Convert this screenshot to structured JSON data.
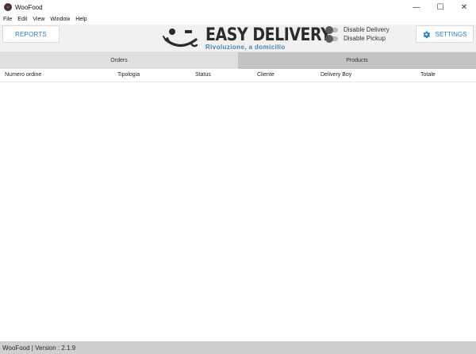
{
  "window": {
    "title": "WooFood",
    "minimize_glyph": "—",
    "maximize_glyph": "☐",
    "close_glyph": "✕"
  },
  "menu": [
    "File",
    "Edit",
    "View",
    "Window",
    "Help"
  ],
  "header": {
    "reports_label": "REPORTS",
    "logo_title": "EASY DELIVERY",
    "logo_subtitle": "Rivoluzione, a domicilio",
    "toggles": [
      {
        "label": "Disable Delivery",
        "on": false
      },
      {
        "label": "Disable Pickup",
        "on": false
      }
    ],
    "settings_label": "SETTINGS",
    "settings_icon": "gear-icon"
  },
  "tabs": [
    {
      "label": "Orders",
      "active": true
    },
    {
      "label": "Products",
      "active": false
    }
  ],
  "table": {
    "columns": [
      "Numero ordine",
      "Tipologia",
      "Status",
      "Cliente",
      "Delivery Boy",
      "Totale"
    ],
    "rows": []
  },
  "status": {
    "text": "WooFood | Version : 2.1.9"
  },
  "colors": {
    "accent": "#2a7fc0",
    "header_bg": "#f1f1f1",
    "tab_orders_bg": "#dfdfdf",
    "tab_products_bg": "#c4c4c4",
    "statusbar_bg": "#cfcfcf"
  }
}
